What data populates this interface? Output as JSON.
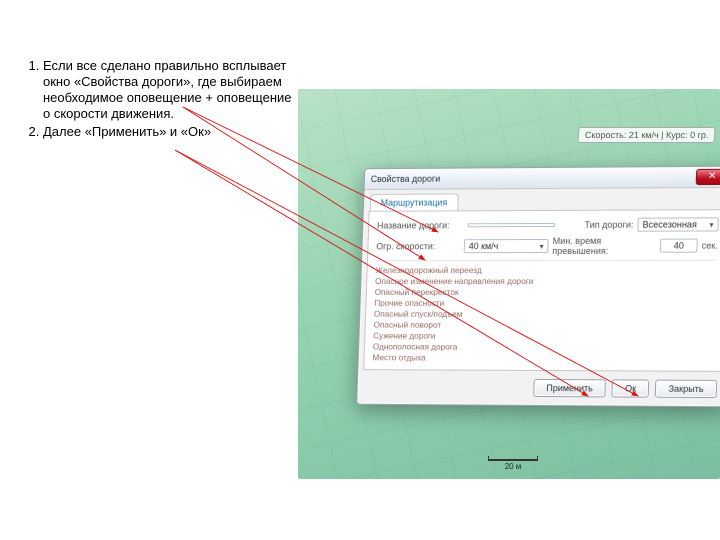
{
  "instructions": {
    "item1": "Если все сделано правильно всплывает окно «Свойства дороги», где выбираем необходимое оповещение + оповещение о скорости движения.",
    "item2": "Далее «Применить» и «Ок»"
  },
  "status_pill": "Скорость: 21 км/ч | Курс: 0 гр.",
  "dialog": {
    "title": "Свойства дороги",
    "tab": "Маршрутизация",
    "name_label": "Название дороги:",
    "name_value": "",
    "type_label": "Тип дороги:",
    "type_value": "Всесезонная",
    "speed_label": "Огр. скорости:",
    "speed_value": "40 км/ч",
    "min_time_label": "Мин. время превышения:",
    "min_time_value": "40",
    "min_time_unit": "сек.",
    "options": [
      "Железнодорожный переезд",
      "Опасное изменение направления дороги",
      "Опасный перекресток",
      "Прочие опасности",
      "Опасный спуск/подъем",
      "Опасный поворот",
      "Сужение дороги",
      "Однополосная дорога",
      "Место отдыха"
    ],
    "btn_apply": "Применить",
    "btn_ok": "Ок",
    "btn_close": "Закрыть"
  },
  "scale": "20 м"
}
